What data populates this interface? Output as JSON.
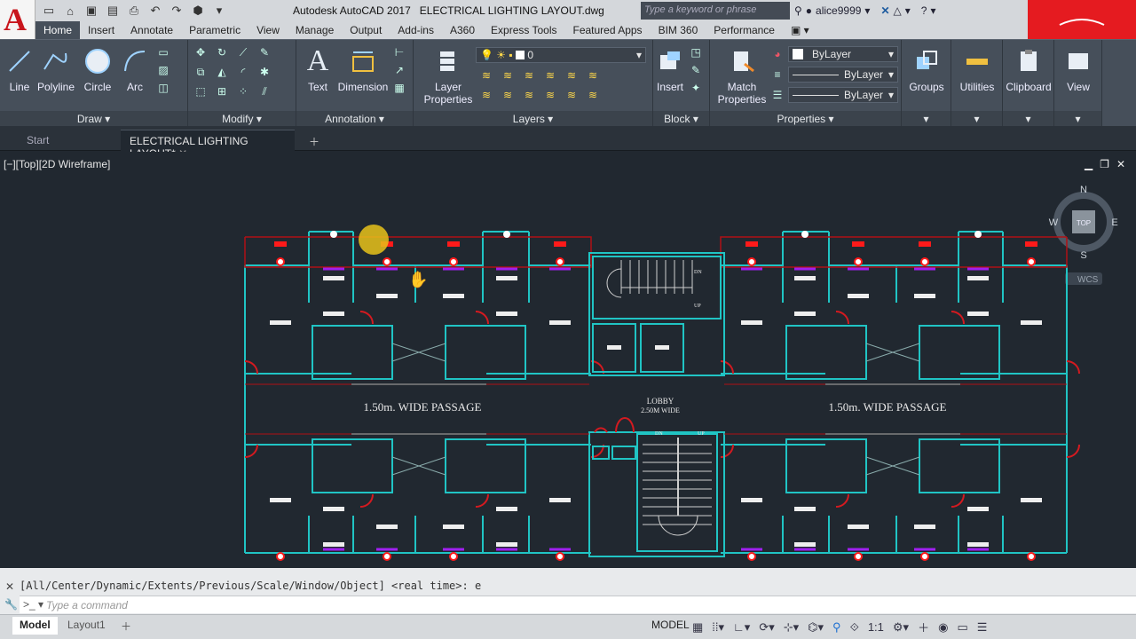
{
  "app": {
    "logo_letter": "A",
    "title": "Autodesk AutoCAD 2017",
    "filename": "ELECTRICAL LIGHTING LAYOUT.dwg"
  },
  "search": {
    "placeholder": "Type a keyword or phrase"
  },
  "user": {
    "name": "alice9999"
  },
  "ribbon_tabs": [
    "Home",
    "Insert",
    "Annotate",
    "Parametric",
    "View",
    "Manage",
    "Output",
    "Add-ins",
    "A360",
    "Express Tools",
    "Featured Apps",
    "BIM 360",
    "Performance"
  ],
  "draw": {
    "line": "Line",
    "polyline": "Polyline",
    "circle": "Circle",
    "arc": "Arc",
    "title": "Draw"
  },
  "modify": {
    "title": "Modify"
  },
  "annotation": {
    "text": "Text",
    "dimension": "Dimension",
    "title": "Annotation"
  },
  "layers": {
    "layer_properties": "Layer Properties",
    "current": "0",
    "title": "Layers"
  },
  "block": {
    "insert": "Insert",
    "title": "Block"
  },
  "properties": {
    "match": "Match Properties",
    "color": "ByLayer",
    "linetype": "ByLayer",
    "lineweight": "ByLayer",
    "title": "Properties"
  },
  "right_panels": {
    "groups": "Groups",
    "utilities": "Utilities",
    "clipboard": "Clipboard",
    "view": "View"
  },
  "doc_tabs": {
    "start": "Start",
    "active": "ELECTRICAL LIGHTING LAYOUT*"
  },
  "viewport": {
    "label": "[−][Top][2D Wireframe]"
  },
  "viewcube": {
    "n": "N",
    "s": "S",
    "e": "E",
    "w": "W",
    "top": "TOP",
    "wcs": "WCS"
  },
  "drawing": {
    "passage_left": "1.50m. WIDE PASSAGE",
    "passage_right": "1.50m. WIDE PASSAGE",
    "lobby": "LOBBY",
    "lobby_width": "2.50M WIDE",
    "dn": "DN",
    "up": "UP"
  },
  "command": {
    "history": "[All/Center/Dynamic/Extents/Previous/Scale/Window/Object] <real time>: e",
    "placeholder": "Type a command"
  },
  "status": {
    "model_tab": "Model",
    "layout_tab": "Layout1",
    "model_btn": "MODEL",
    "scale": "1:1"
  },
  "colors": {
    "walls": "#20c4c4",
    "fixtures": "#ff1a1a",
    "switches": "#a020f0",
    "background": "#212830",
    "brand": "#e51b20"
  }
}
